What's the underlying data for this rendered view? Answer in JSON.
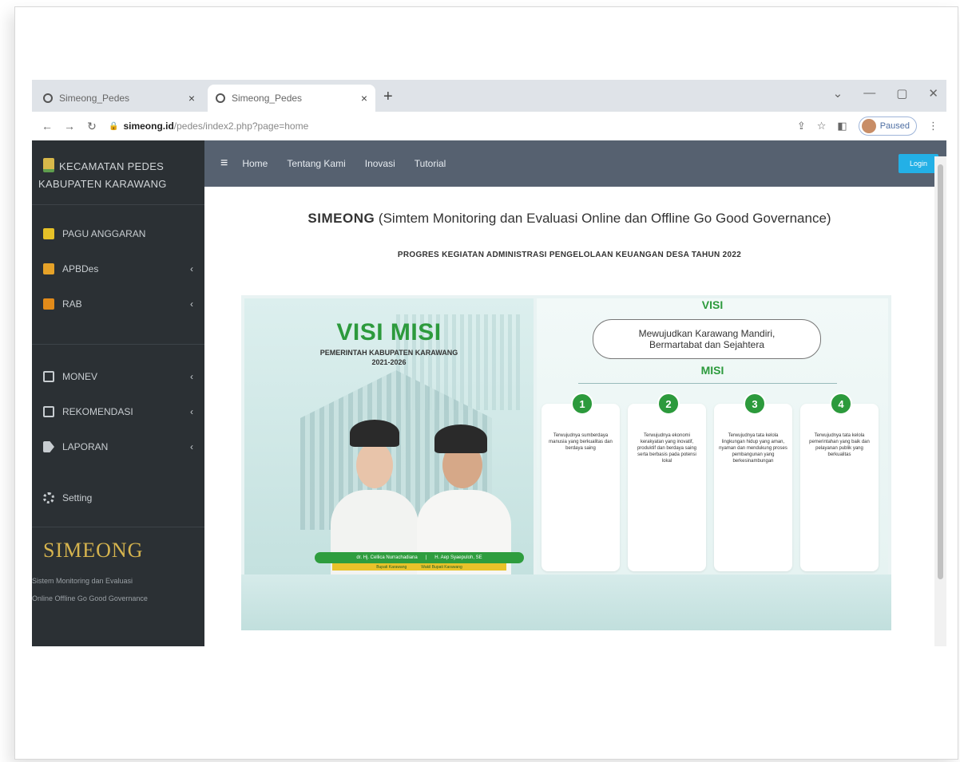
{
  "browser": {
    "tabs": [
      {
        "title": "Simeong_Pedes"
      },
      {
        "title": "Simeong_Pedes"
      }
    ],
    "new_tab": "+",
    "window_controls": [
      "⌄",
      "—",
      "▢",
      "✕"
    ],
    "url_host": "simeong.id",
    "url_path": "/pedes/index2.php?page=home",
    "profile_label": "Paused"
  },
  "sidebar": {
    "brand_line1": "KECAMATAN PEDES",
    "brand_line2": "KABUPATEN KARAWANG",
    "items": [
      {
        "label": "PAGU ANGGARAN",
        "icon": "document-icon"
      },
      {
        "label": "APBDes",
        "icon": "document-icon",
        "arrow": "‹"
      },
      {
        "label": "RAB",
        "icon": "table-icon",
        "arrow": "‹"
      },
      {
        "label": "MONEV",
        "icon": "edit-icon",
        "arrow": "‹"
      },
      {
        "label": "REKOMENDASI",
        "icon": "document-icon",
        "arrow": "‹"
      },
      {
        "label": "LAPORAN",
        "icon": "report-icon",
        "arrow": "‹"
      },
      {
        "label": "Setting",
        "icon": "gears-icon"
      }
    ],
    "logo_text": "SIMEONG",
    "tagline_line1": "Sistem Monitoring dan Evaluasi",
    "tagline_line2": "Online Offline Go Good Governance"
  },
  "topnav": {
    "menu_icon": "≡",
    "links": [
      "Home",
      "Tentang Kami",
      "Inovasi",
      "Tutorial"
    ],
    "login_label": "Login"
  },
  "main": {
    "title_bold": "SIMEONG",
    "title_rest": " (Simtem Monitoring dan Evaluasi Online dan Offline Go Good Governance)",
    "subtitle": "PROGRES KEGIATAN ADMINISTRASI PENGELOLAAN KEUANGAN DESA TAHUN 2022"
  },
  "banner": {
    "heading": "VISI MISI",
    "subheading_line1": "PEMERINTAH KABUPATEN KARAWANG",
    "subheading_line2": "2021-2026",
    "name_left": "dr. Hj. Cellica Nurrachadiana",
    "name_right": "H. Aep Syaepuloh, SE",
    "role_left": "Bupati Karawang",
    "role_right": "Wakil Bupati Karawang",
    "visi_label": "VISI",
    "visi_line1": "Mewujudkan Karawang Mandiri,",
    "visi_line2": "Bermartabat dan Sejahtera",
    "misi_label": "MISI",
    "misi": [
      {
        "num": "1",
        "text": "Terwujudnya sumberdaya manusia yang berkualitas dan berdaya saing"
      },
      {
        "num": "2",
        "text": "Terwujudnya ekonomi kerakyatan yang inovatif, produktif dan berdaya saing serta berbasis pada potensi lokal"
      },
      {
        "num": "3",
        "text": "Terwujudnya tata kelola lingkungan hidup yang aman, nyaman dan mendukung proses pembangunan yang berkesinambungan"
      },
      {
        "num": "4",
        "text": "Terwujudnya tata kelola pemerintahan yang baik dan pelayanan publik yang berkualitas"
      }
    ]
  }
}
